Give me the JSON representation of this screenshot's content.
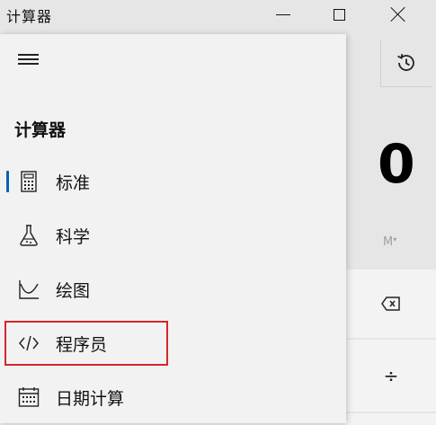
{
  "window": {
    "title": "计算器",
    "controls": {
      "minimize": "minimize",
      "maximize": "maximize",
      "close": "close"
    }
  },
  "nav": {
    "heading": "计算器",
    "items": [
      {
        "label": "标准",
        "icon": "calculator-icon",
        "selected": true
      },
      {
        "label": "科学",
        "icon": "flask-icon",
        "selected": false
      },
      {
        "label": "绘图",
        "icon": "graph-icon",
        "selected": false
      },
      {
        "label": "程序员",
        "icon": "code-icon",
        "selected": false,
        "highlighted": true
      },
      {
        "label": "日期计算",
        "icon": "calendar-icon",
        "selected": false
      }
    ]
  },
  "calculator": {
    "display": "0",
    "memory_label": "M",
    "keys": {
      "divide": "÷"
    }
  },
  "colors": {
    "accent": "#0063b1",
    "highlight": "#d4272b"
  }
}
